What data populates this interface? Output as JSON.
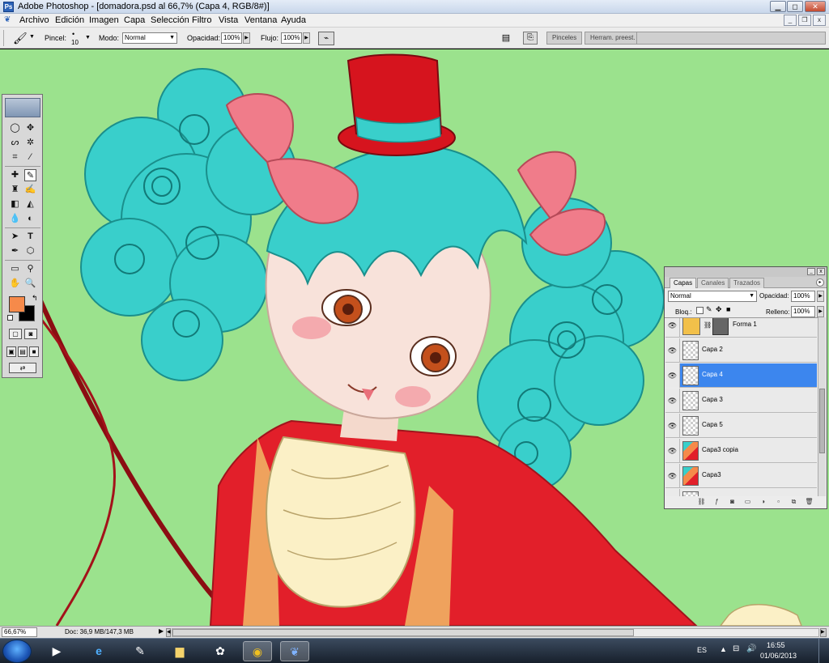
{
  "window": {
    "app_icon": "Ps",
    "title": "Adobe Photoshop - [domadora.psd al 66,7% (Capa 4, RGB/8#)]",
    "controls": {
      "minimize": "▁",
      "maximize": "◻",
      "close": "✕"
    }
  },
  "menu": {
    "items": [
      "Archivo",
      "Edición",
      "Imagen",
      "Capa",
      "Selección",
      "Filtro",
      "Vista",
      "Ventana",
      "Ayuda"
    ],
    "doc_controls": {
      "minimize": "_",
      "restore": "❐",
      "close": "x"
    }
  },
  "options": {
    "brush_label": "Pincel:",
    "brush_size": "10",
    "mode_label": "Modo:",
    "mode_value": "Normal",
    "opacity_label": "Opacidad:",
    "opacity_value": "100%",
    "flow_label": "Flujo:",
    "flow_value": "100%",
    "well_tabs": [
      "Pinceles",
      "Herram. preest."
    ]
  },
  "layers_panel": {
    "tabs": [
      "Capas",
      "Canales",
      "Trazados"
    ],
    "blend_mode": "Normal",
    "opacity_label": "Opacidad:",
    "opacity_value": "100%",
    "lock_label": "Bloq.:",
    "fill_label": "Relleno:",
    "fill_value": "100%",
    "layers": [
      {
        "name": "Forma 1",
        "visible": true,
        "selected": false
      },
      {
        "name": "Capa 2",
        "visible": true,
        "selected": false
      },
      {
        "name": "Capa 4",
        "visible": true,
        "selected": true
      },
      {
        "name": "Capa 3",
        "visible": true,
        "selected": false
      },
      {
        "name": "Capa 5",
        "visible": true,
        "selected": false
      },
      {
        "name": "Capa3 copia",
        "visible": true,
        "selected": false
      },
      {
        "name": "Capa3",
        "visible": true,
        "selected": false
      }
    ]
  },
  "toolbox": {
    "foreground_color": "#f68a4a",
    "background_color": "#000000"
  },
  "status": {
    "zoom": "66,67%",
    "doc_info": "Doc: 36,9 MB/147,3 MB"
  },
  "taskbar": {
    "language": "ES",
    "time": "16:55",
    "date": "01/06/2013"
  },
  "colors": {
    "canvas_bg": "#9be28d",
    "hair": "#35d0cc",
    "jacket": "#e21f2a",
    "bow": "#f07c8a",
    "selected_layer": "#3c86ee"
  }
}
